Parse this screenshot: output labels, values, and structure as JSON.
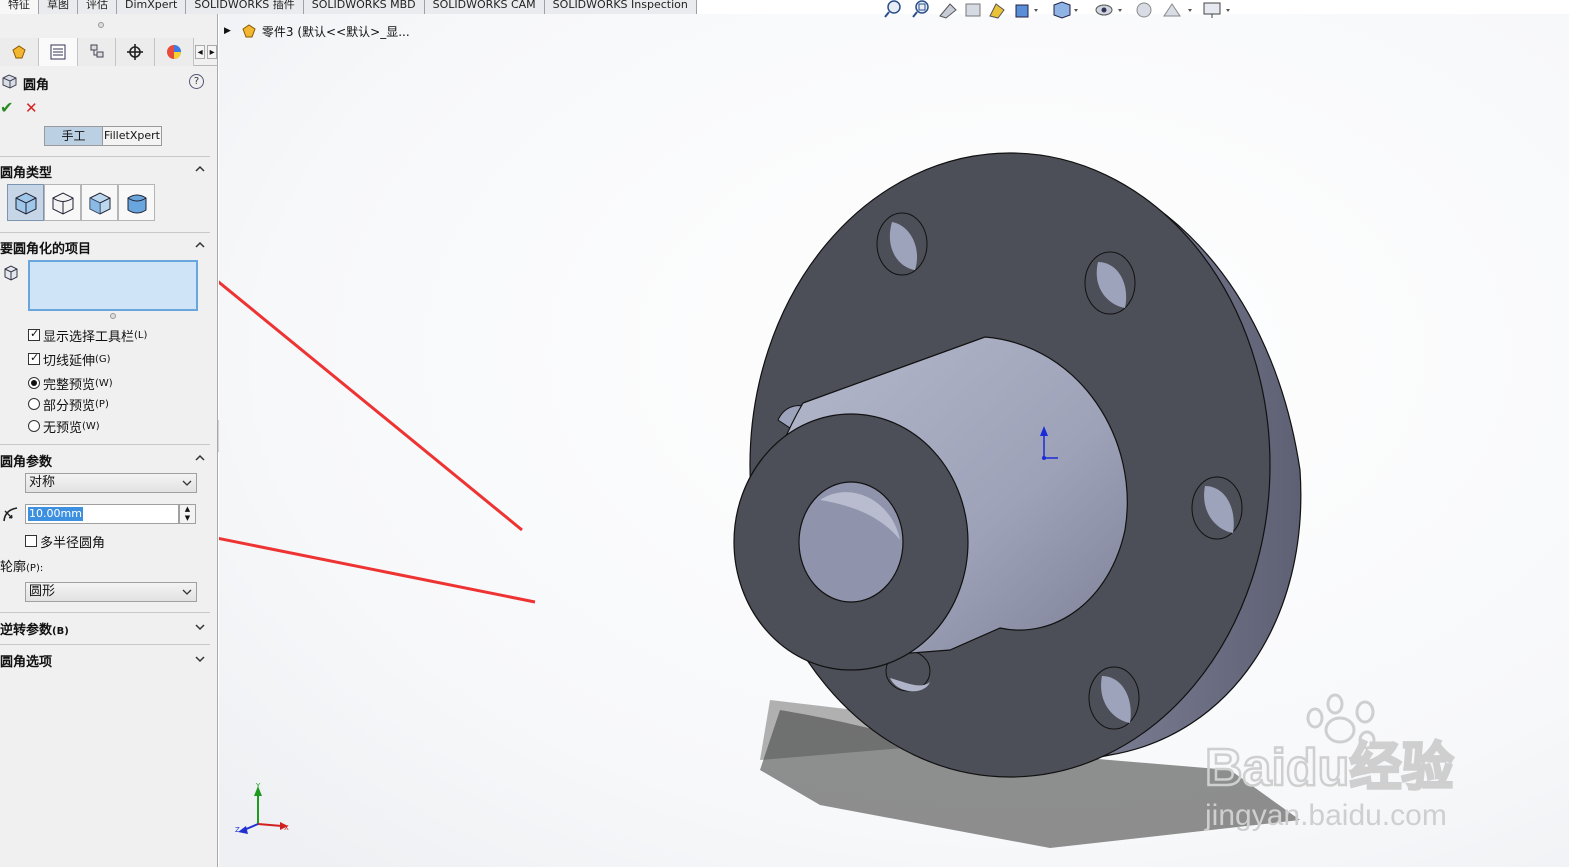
{
  "command_tabs": [
    "特征",
    "草图",
    "评估",
    "DimXpert",
    "SOLIDWORKS 插件",
    "SOLIDWORKS MBD",
    "SOLIDWORKS CAM",
    "SOLIDWORKS Inspection"
  ],
  "property_manager": {
    "feature_name": "圆角",
    "help_icon": "?",
    "mode_tabs": {
      "manual": "手工",
      "filletxpert": "FilletXpert"
    },
    "sections": {
      "fillet_type": "圆角类型",
      "items_to_fillet": "要圆角化的项目",
      "fillet_params": "圆角参数",
      "reverse_params": "逆转参数",
      "reverse_params_key": "(B)",
      "fillet_options": "圆角选项"
    },
    "options": [
      {
        "label": "显示选择工具栏",
        "key": "(L)",
        "type": "checkbox",
        "checked": true
      },
      {
        "label": "切线延伸",
        "key": "(G)",
        "type": "checkbox",
        "checked": true
      },
      {
        "label": "完整预览",
        "key": "(W)",
        "type": "radio",
        "checked": true
      },
      {
        "label": "部分预览",
        "key": "(P)",
        "type": "radio",
        "checked": false
      },
      {
        "label": "无预览",
        "key": "(W)",
        "type": "radio",
        "checked": false
      }
    ],
    "method_select": "对称",
    "radius_value": "10.00mm",
    "multi_radius_label": "多半径圆角",
    "profile_label": "轮廓",
    "profile_key": "(P):",
    "profile_select": "圆形"
  },
  "tree": {
    "part_label": "零件3  (默认<<默认>_显..."
  },
  "triad": {
    "x": "X",
    "y": "Y",
    "z": "Z"
  },
  "watermark": {
    "brand": "Baidu经验",
    "url": "jingyan.baidu.com"
  },
  "colors": {
    "accent_blue": "#3d8fe0",
    "selection_box": "#cfe5f7",
    "ok_green": "#2a8a1f",
    "cancel_red": "#d42020",
    "annotation_arrow": "#ee3333",
    "part_face": "#4d4f58"
  }
}
